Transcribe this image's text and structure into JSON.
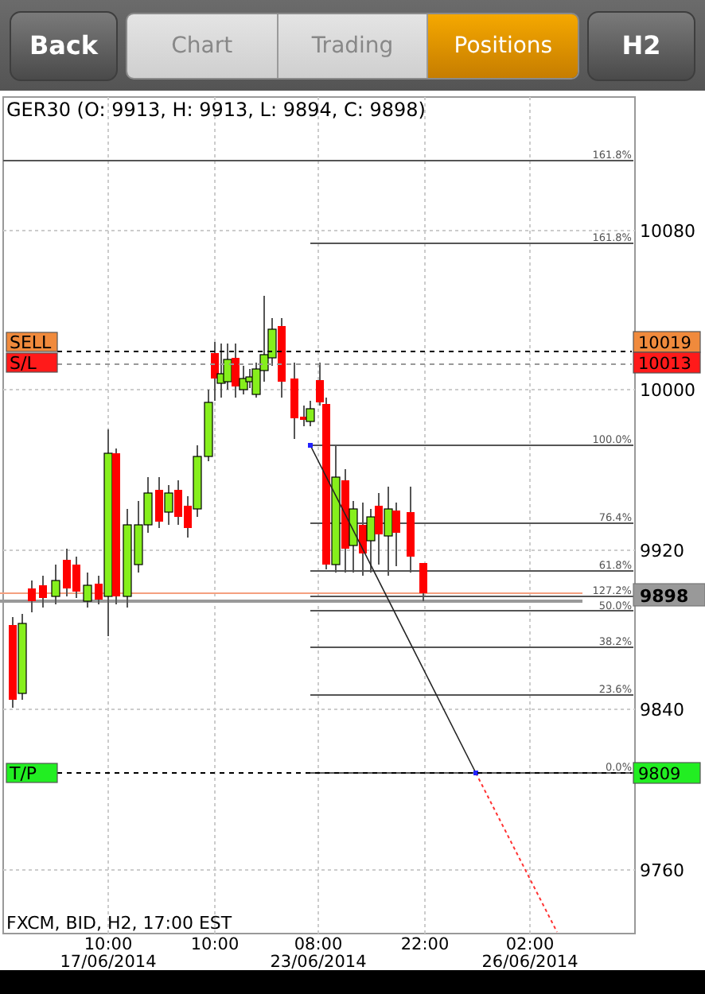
{
  "toolbar": {
    "back": "Back",
    "timeframe": "H2"
  },
  "tabs": [
    {
      "label": "Chart",
      "selected": false
    },
    {
      "label": "Trading",
      "selected": false
    },
    {
      "label": "Positions",
      "selected": true
    }
  ],
  "chart": {
    "title": "GER30 (O: 9913, H: 9913, L: 9894, C: 9898)",
    "footer": "FXCM, BID, H2, 17:00 EST",
    "y_axis": [
      "10080",
      "10000",
      "9920",
      "9840",
      "9760"
    ],
    "x_axis": [
      {
        "time": "10:00",
        "date": "17/06/2014"
      },
      {
        "time": "10:00"
      },
      {
        "time": "08:00",
        "date": "23/06/2014"
      },
      {
        "time": "22:00"
      },
      {
        "time": "02:00",
        "date": "26/06/2014"
      }
    ],
    "fib_levels": [
      {
        "label": "161.8%"
      },
      {
        "label": "161.8%"
      },
      {
        "label": "100.0%"
      },
      {
        "label": "76.4%"
      },
      {
        "label": "61.8%"
      },
      {
        "label": "127.2%"
      },
      {
        "label": "50.0%"
      },
      {
        "label": "38.2%"
      },
      {
        "label": "23.6%"
      },
      {
        "label": "0.0%"
      }
    ],
    "orders": [
      {
        "kind": "sell",
        "label": "SELL",
        "price": "10019"
      },
      {
        "kind": "stop_loss",
        "label": "S/L",
        "price": "10013"
      },
      {
        "kind": "take_profit",
        "label": "T/P",
        "price": "9809"
      }
    ],
    "current_price": "9898"
  }
}
